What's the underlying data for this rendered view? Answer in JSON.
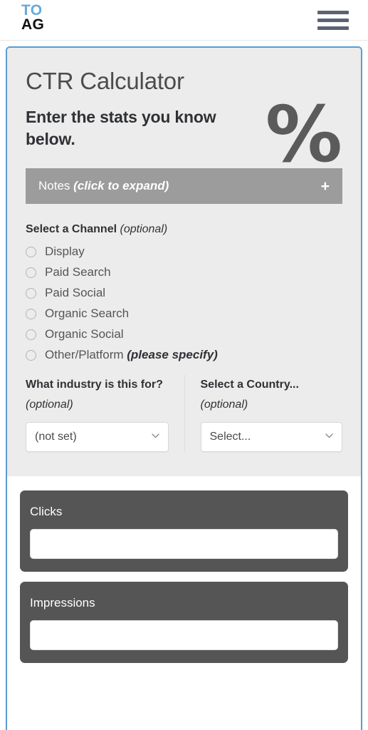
{
  "header": {
    "logo_line1": "TO",
    "logo_line2": "AG",
    "menu_icon": "hamburger-menu-icon"
  },
  "card": {
    "title": "CTR Calculator",
    "subtitle": "Enter the stats you know below.",
    "percent_glyph": "%",
    "notes": {
      "label": "Notes ",
      "emphasis": "(click to expand)",
      "expand_icon": "+"
    },
    "channel": {
      "heading": "Select a Channel ",
      "heading_emphasis": "(optional)",
      "options": [
        {
          "label": "Display",
          "emphasis": ""
        },
        {
          "label": "Paid Search",
          "emphasis": ""
        },
        {
          "label": "Paid Social",
          "emphasis": ""
        },
        {
          "label": "Organic Search",
          "emphasis": ""
        },
        {
          "label": "Organic Social",
          "emphasis": ""
        },
        {
          "label": "Other/Platform ",
          "emphasis": "(please specify)"
        }
      ]
    },
    "industry": {
      "label": "What industry is this for? ",
      "label_emphasis": "(optional)",
      "selected": "(not set)"
    },
    "country": {
      "label": "Select a Country... ",
      "label_emphasis": "(optional)",
      "selected": "Select..."
    },
    "metrics": [
      {
        "label": "Clicks",
        "value": "",
        "placeholder": ""
      },
      {
        "label": "Impressions",
        "value": "",
        "placeholder": ""
      }
    ]
  },
  "colors": {
    "accent_border": "#5b9bd1",
    "logo_blue": "#6aa9d8",
    "panel_dark": "#555555",
    "notes_gray": "#9c9c9c",
    "card_bg": "#ececec"
  }
}
